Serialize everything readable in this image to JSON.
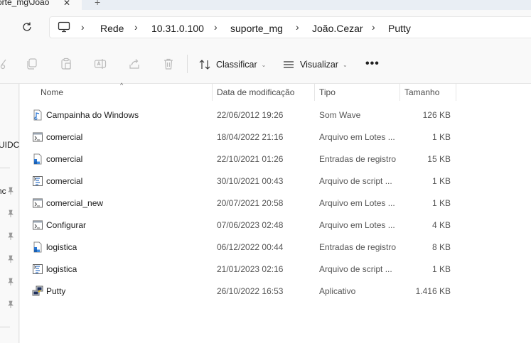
{
  "tab": {
    "title": "orte_mg\\Joao",
    "close": "✕",
    "new_tab": "+"
  },
  "breadcrumb": {
    "items": [
      "Rede",
      "10.31.0.100",
      "suporte_mg",
      "João.Cezar",
      "Putty"
    ],
    "separator": "›"
  },
  "toolbar": {
    "sort_label": "Classificar",
    "view_label": "Visualizar",
    "more_label": "•••"
  },
  "navpane": {
    "fragments": [
      "UIDC",
      "nc"
    ]
  },
  "columns": {
    "name": "Nome",
    "date": "Data de modificação",
    "type": "Tipo",
    "size": "Tamanho"
  },
  "files": [
    {
      "name": "Campainha do Windows",
      "date": "22/06/2012 19:26",
      "type": "Som Wave",
      "size": "126 KB",
      "icon": "audio-file-icon"
    },
    {
      "name": "comercial",
      "date": "18/04/2022 21:16",
      "type": "Arquivo em Lotes ...",
      "size": "1 KB",
      "icon": "batch-file-icon"
    },
    {
      "name": "comercial",
      "date": "22/10/2021 01:26",
      "type": "Entradas de registro",
      "size": "15 KB",
      "icon": "registry-file-icon"
    },
    {
      "name": "comercial",
      "date": "30/10/2021 00:43",
      "type": "Arquivo de script ...",
      "size": "1 KB",
      "icon": "script-file-icon"
    },
    {
      "name": "comercial_new",
      "date": "20/07/2021 20:58",
      "type": "Arquivo em Lotes ...",
      "size": "1 KB",
      "icon": "batch-file-icon"
    },
    {
      "name": "Configurar",
      "date": "07/06/2023 02:48",
      "type": "Arquivo em Lotes ...",
      "size": "4 KB",
      "icon": "batch-file-icon"
    },
    {
      "name": "logistica",
      "date": "06/12/2022 00:44",
      "type": "Entradas de registro",
      "size": "8 KB",
      "icon": "registry-file-icon"
    },
    {
      "name": "logistica",
      "date": "21/01/2023 02:16",
      "type": "Arquivo de script ...",
      "size": "1 KB",
      "icon": "script-file-icon"
    },
    {
      "name": "Putty",
      "date": "26/10/2022 16:53",
      "type": "Aplicativo",
      "size": "1.416 KB",
      "icon": "putty-app-icon"
    }
  ]
}
